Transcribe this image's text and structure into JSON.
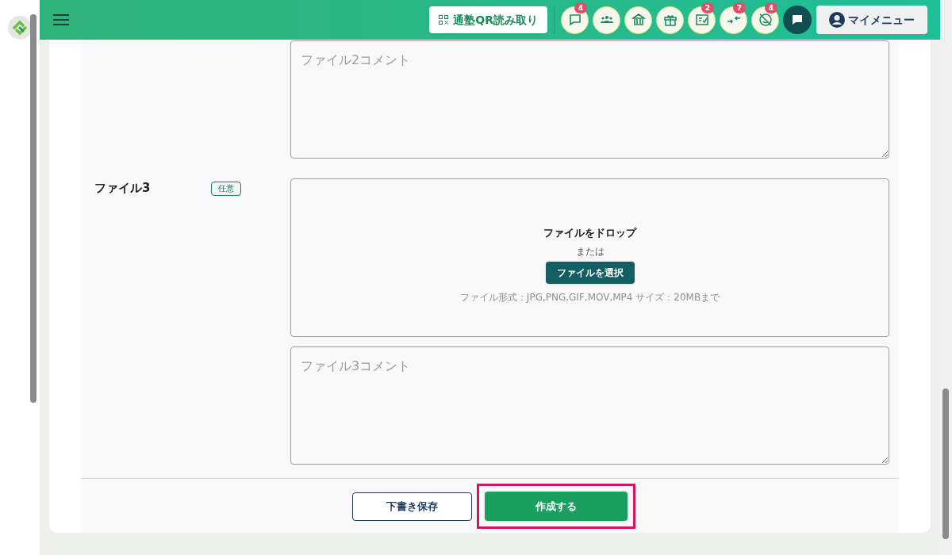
{
  "header": {
    "qr_button": "通塾QR読み取り",
    "icons": [
      {
        "kind": "chat",
        "badge": "4"
      },
      {
        "kind": "people"
      },
      {
        "kind": "bank"
      },
      {
        "kind": "gift"
      },
      {
        "kind": "checklist",
        "badge": "2"
      },
      {
        "kind": "arrows",
        "badge": "7"
      },
      {
        "kind": "face-off",
        "badge": "4"
      },
      {
        "kind": "message"
      }
    ],
    "my_menu": "マイメニュー"
  },
  "form": {
    "file2_comment": {
      "placeholder": "ファイル2コメント"
    },
    "file3": {
      "label": "ファイル3",
      "tag": "任意",
      "drop_title": "ファイルをドロップ",
      "or": "または",
      "select_button": "ファイルを選択",
      "hint": "ファイル形式：JPG,PNG,GIF,MOV,MP4 サイズ：20MBまで",
      "comment": {
        "placeholder": "ファイル3コメント"
      }
    }
  },
  "footer": {
    "draft_button": "下書き保存",
    "create_button": "作成する",
    "create_highlighted": true
  }
}
